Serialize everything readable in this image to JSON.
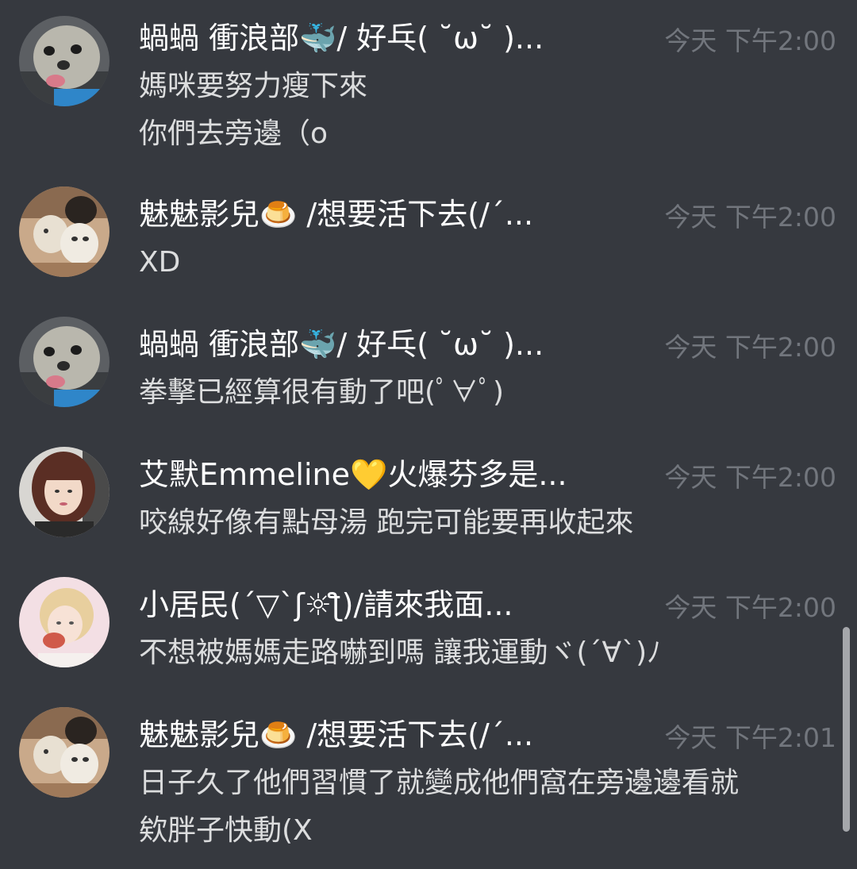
{
  "colors": {
    "background": "#36393f",
    "username": "#ffffff",
    "message_text": "#dcddde",
    "timestamp": "#72767d",
    "scrollbar": "#b9bbbe"
  },
  "messages": [
    {
      "username": "蝸蝸 衝浪部🐳/ 好乓( ˘ω˘ )...",
      "timestamp": "今天 下午2:00",
      "avatar_icon": "dog-avatar-icon",
      "lines": [
        "媽咪要努力瘦下來",
        "你們去旁邊（o"
      ]
    },
    {
      "username": "魅魅影兒🍮 /想要活下去(/´...",
      "timestamp": "今天 下午2:00",
      "avatar_icon": "cats-avatar-icon",
      "lines": [
        "XD"
      ]
    },
    {
      "username": "蝸蝸 衝浪部🐳/ 好乓( ˘ω˘ )...",
      "timestamp": "今天 下午2:00",
      "avatar_icon": "dog-avatar-icon",
      "lines": [
        "拳擊已經算很有動了吧(ﾟ∀ﾟ)"
      ]
    },
    {
      "username": "艾默Emmeline💛火爆芬多是...",
      "timestamp": "今天 下午2:00",
      "avatar_icon": "girl-avatar-icon",
      "lines": [
        "咬線好像有點母湯 跑完可能要再收起來"
      ]
    },
    {
      "username": "小居民(´▽`ʃ☼ƪ)/請來我面...",
      "timestamp": "今天 下午2:00",
      "avatar_icon": "blonde-avatar-icon",
      "lines": [
        "不想被媽媽走路嚇到嗎  讓我運動ヾ(´∀`)ﾉ"
      ]
    },
    {
      "username": "魅魅影兒🍮 /想要活下去(/´...",
      "timestamp": "今天 下午2:01",
      "avatar_icon": "cats-avatar-icon",
      "lines": [
        " 日子久了他們習慣了就變成他們窩在旁邊邊看就",
        "欸胖子快動(X"
      ]
    }
  ]
}
